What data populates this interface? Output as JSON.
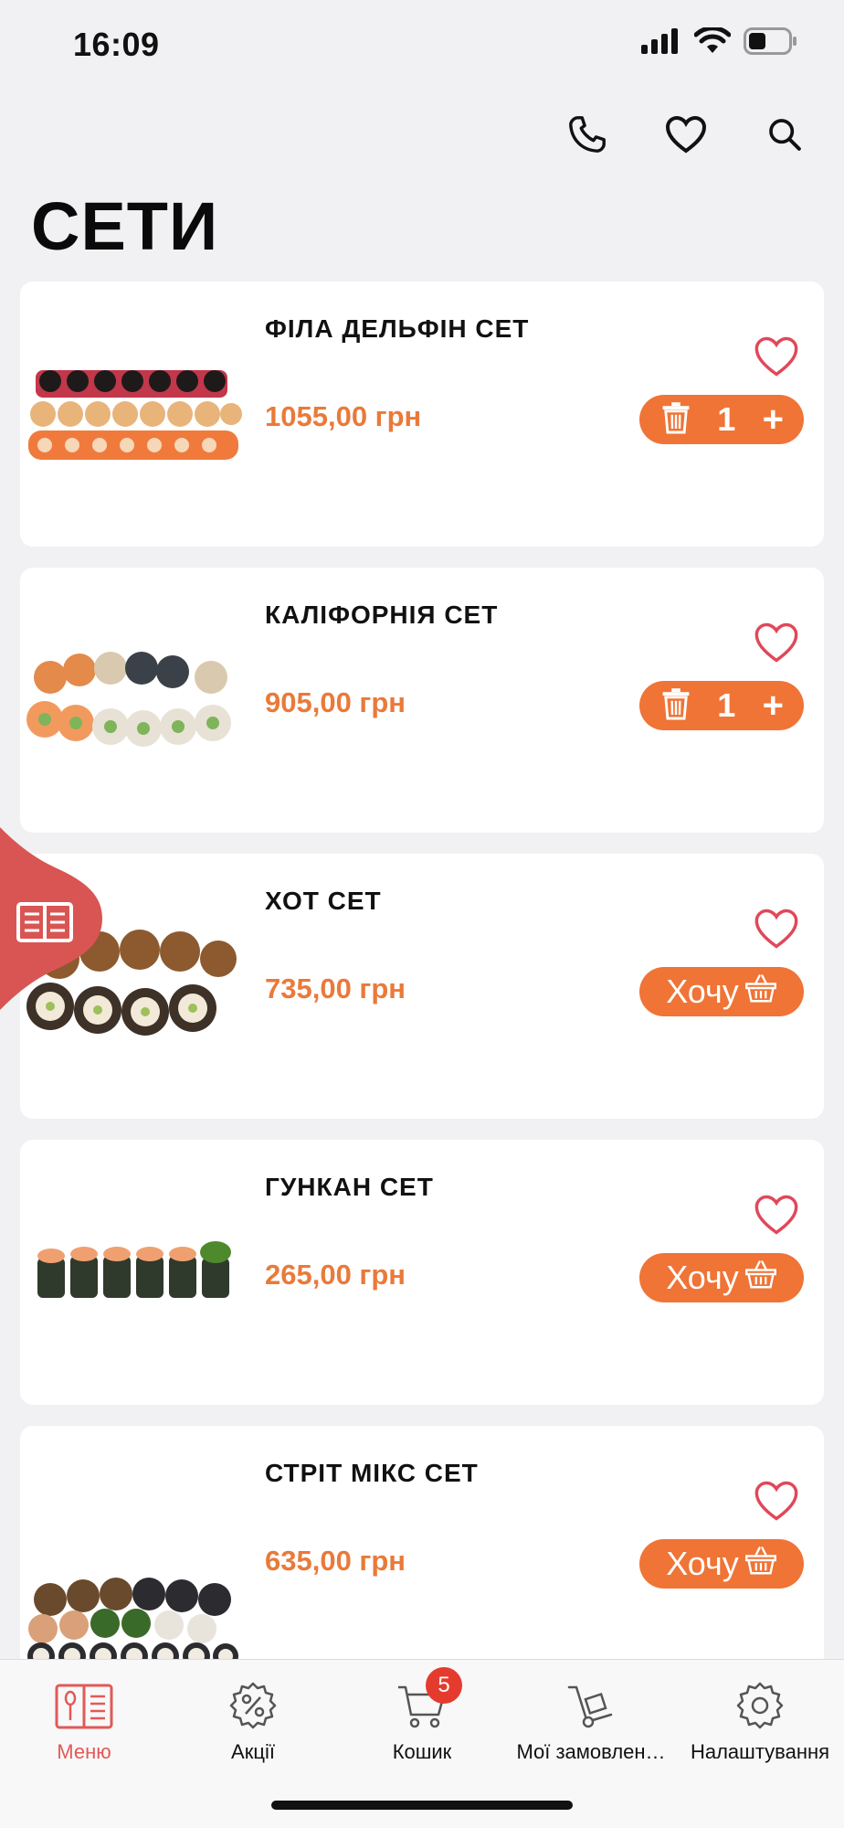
{
  "status": {
    "time": "16:09",
    "battery_level": 0.45
  },
  "header": {
    "title": "СЕТИ"
  },
  "icons": {
    "phone": "phone-icon",
    "favorites": "heart-icon",
    "search": "search-icon"
  },
  "colors": {
    "accent": "#ef7436",
    "price": "#e97a3a",
    "heart": "#e0485a",
    "side_tab": "#d95553",
    "badge": "#e53b2e"
  },
  "products": [
    {
      "name": "ФІЛА ДЕЛЬФІН СЕТ",
      "price": "1055,00 грн",
      "in_cart": true,
      "quantity": "1"
    },
    {
      "name": "КАЛІФОРНІЯ СЕТ",
      "price": "905,00 грн",
      "in_cart": true,
      "quantity": "1"
    },
    {
      "name": "ХОТ СЕТ",
      "price": "735,00 грн",
      "in_cart": false,
      "button_label": "Хочу"
    },
    {
      "name": "ГУНКАН СЕТ",
      "price": "265,00 грн",
      "in_cart": false,
      "button_label": "Хочу"
    },
    {
      "name": "СТРІТ МІКС СЕТ",
      "price": "635,00 грн",
      "in_cart": false,
      "button_label": "Хочу"
    }
  ],
  "tabs": [
    {
      "label": "Меню",
      "icon": "menu-book-icon",
      "active": true
    },
    {
      "label": "Акції",
      "icon": "percent-gear-icon",
      "active": false
    },
    {
      "label": "Кошик",
      "icon": "cart-icon",
      "active": false,
      "badge": "5"
    },
    {
      "label": "Мої замовлен…",
      "icon": "hand-truck-icon",
      "active": false
    },
    {
      "label": "Налаштування",
      "icon": "settings-icon",
      "active": false
    }
  ]
}
